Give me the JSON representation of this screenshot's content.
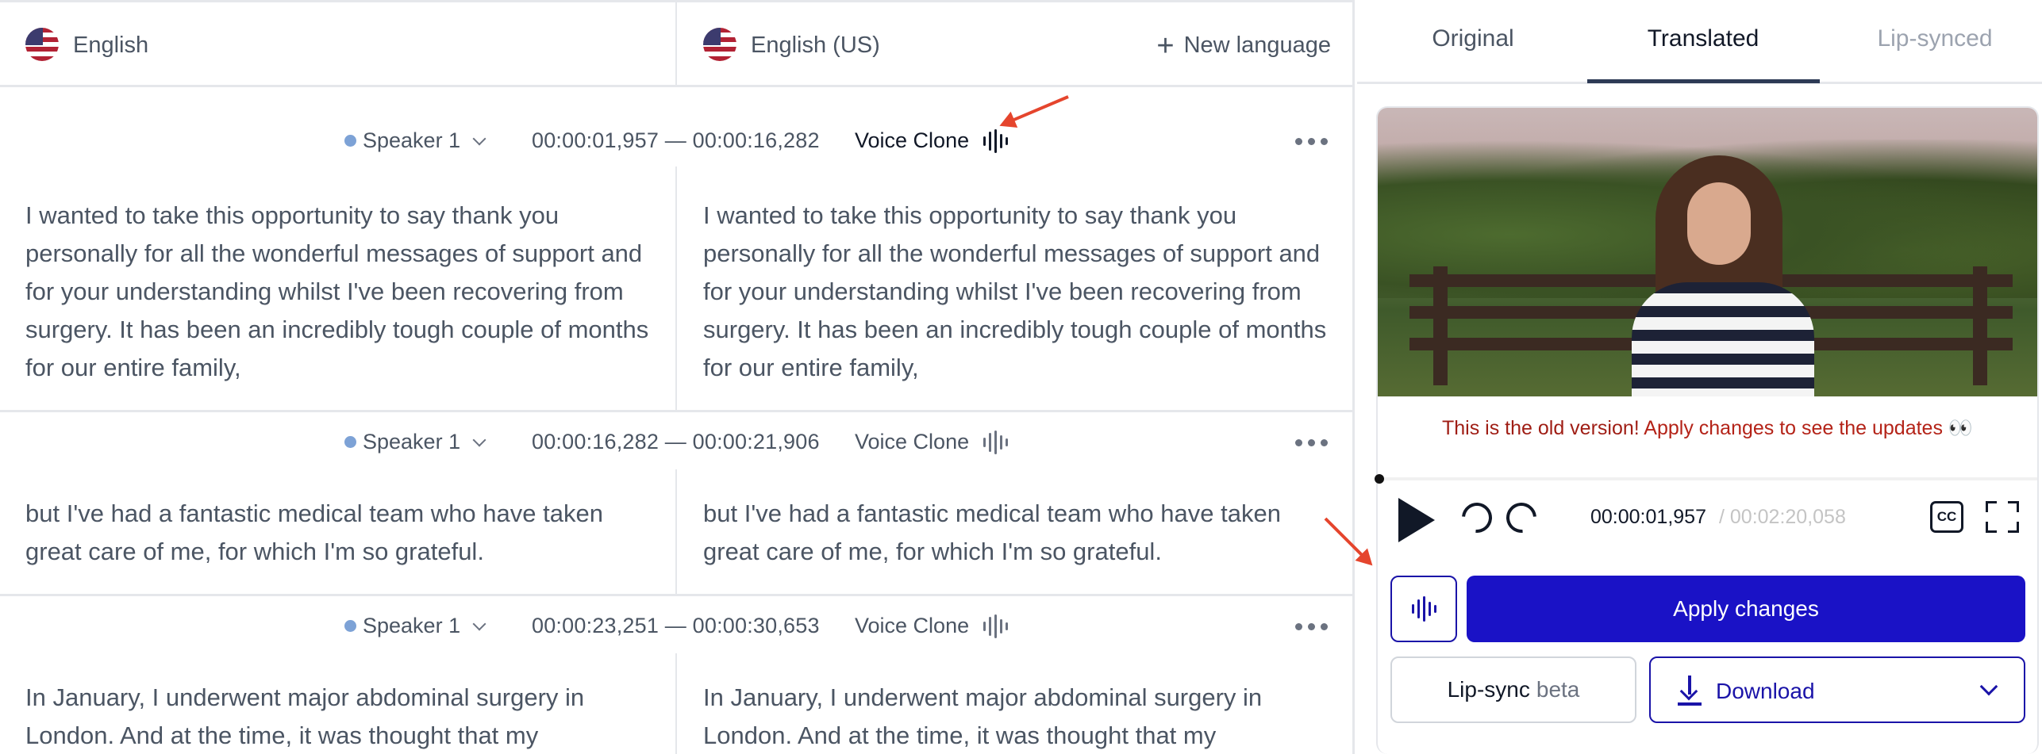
{
  "languages": {
    "source": "English",
    "target": "English (US)",
    "new_language": "New language"
  },
  "segments": [
    {
      "speaker": "Speaker 1",
      "time": "00:00:01,957 — 00:00:16,282",
      "voice": "Voice Clone",
      "source_text": "I wanted to take this opportunity to say thank you personally for all the wonderful messages of support and for your understanding whilst I've been recovering from surgery. It has been an incredibly tough couple of months for our entire family,",
      "target_text": "I wanted to take this opportunity to say thank you personally for all the wonderful messages of support and for your understanding whilst I've been recovering from surgery. It has been an incredibly tough couple of months for our entire family,"
    },
    {
      "speaker": "Speaker 1",
      "time": "00:00:16,282 — 00:00:21,906",
      "voice": "Voice Clone",
      "source_text": "but I've had a fantastic medical team who have taken great care of me, for which I'm so grateful.",
      "target_text": "but I've had a fantastic medical team who have taken great care of me, for which I'm so grateful."
    },
    {
      "speaker": "Speaker 1",
      "time": "00:00:23,251 — 00:00:30,653",
      "voice": "Voice Clone",
      "source_text": "In January, I underwent major abdominal surgery in London. And at the time, it was thought that my",
      "target_text": "In January, I underwent major abdominal surgery in London. And at the time, it was thought that my"
    }
  ],
  "tabs": [
    "Original",
    "Translated",
    "Lip-synced"
  ],
  "player": {
    "notice_bold": "This is the old version!",
    "notice_rest": "Apply changes to see the updates 👀",
    "current_time": "00:00:01,957",
    "total_time": "/ 00:02:20,058",
    "cc_label": "CC",
    "progress": 0.0
  },
  "actions": {
    "apply": "Apply changes",
    "lipsync": "Lip-sync",
    "lipsync_badge": "beta",
    "download": "Download"
  },
  "colors": {
    "accent": "#1a12c6",
    "notice": "#b42318",
    "annotation_arrow": "#e5452d"
  }
}
